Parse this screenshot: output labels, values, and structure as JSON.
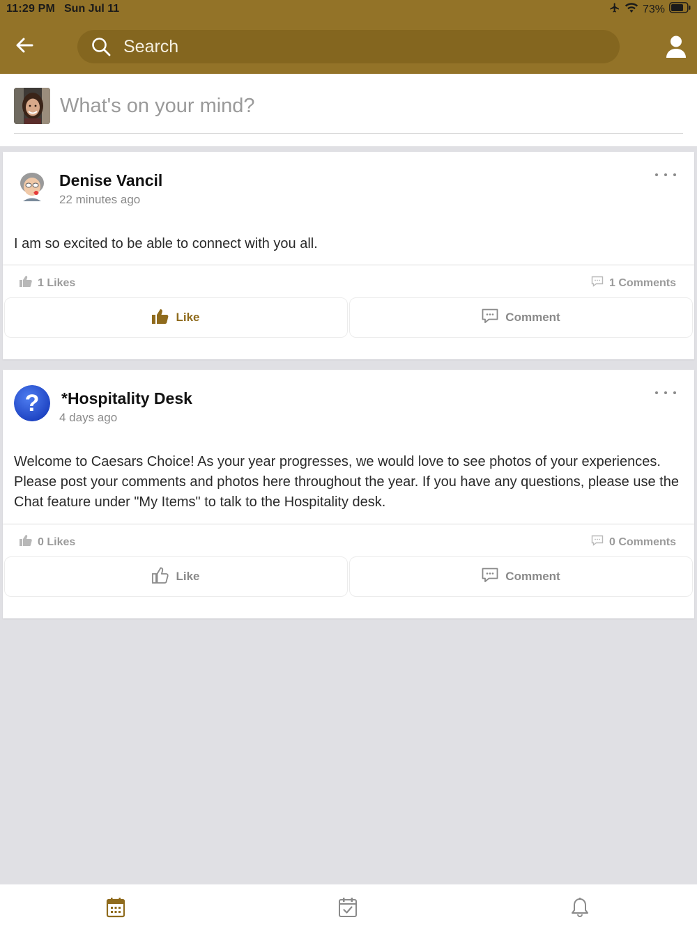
{
  "status_bar": {
    "time": "11:29 PM",
    "date": "Sun Jul 11",
    "battery": "73%",
    "icons": [
      "airplane-icon",
      "wifi-icon",
      "battery-icon"
    ]
  },
  "header": {
    "search_placeholder": "Search",
    "icons": [
      "back-arrow-icon",
      "search-icon",
      "user-profile-icon"
    ]
  },
  "composer": {
    "prompt": "What's on your mind?"
  },
  "posts": [
    {
      "author": "Denise Vancil",
      "time": "22 minutes ago",
      "body": "I am so excited to be able to connect with you all.",
      "likes": "1 Likes",
      "comments": "1 Comments",
      "like_label": "Like",
      "comment_label": "Comment",
      "liked": true
    },
    {
      "author": "*Hospitality Desk",
      "time": "4 days ago",
      "body": "Welcome to Caesars Choice! As your year progresses, we would love to see photos of your experiences. Please post your comments and photos here throughout the year. If you have any questions, please use the Chat feature under \"My Items\" to talk to the Hospitality desk.",
      "likes": "0 Likes",
      "comments": "0 Comments",
      "like_label": "Like",
      "comment_label": "Comment",
      "liked": false
    }
  ],
  "tabbar": {
    "tabs": [
      "calendar-icon",
      "task-check-icon",
      "notifications-bell-icon"
    ]
  },
  "colors": {
    "brand": "#937328",
    "brand_dark": "#84661f",
    "accent_liked": "#8f6b1d",
    "background": "#e0e0e4"
  }
}
